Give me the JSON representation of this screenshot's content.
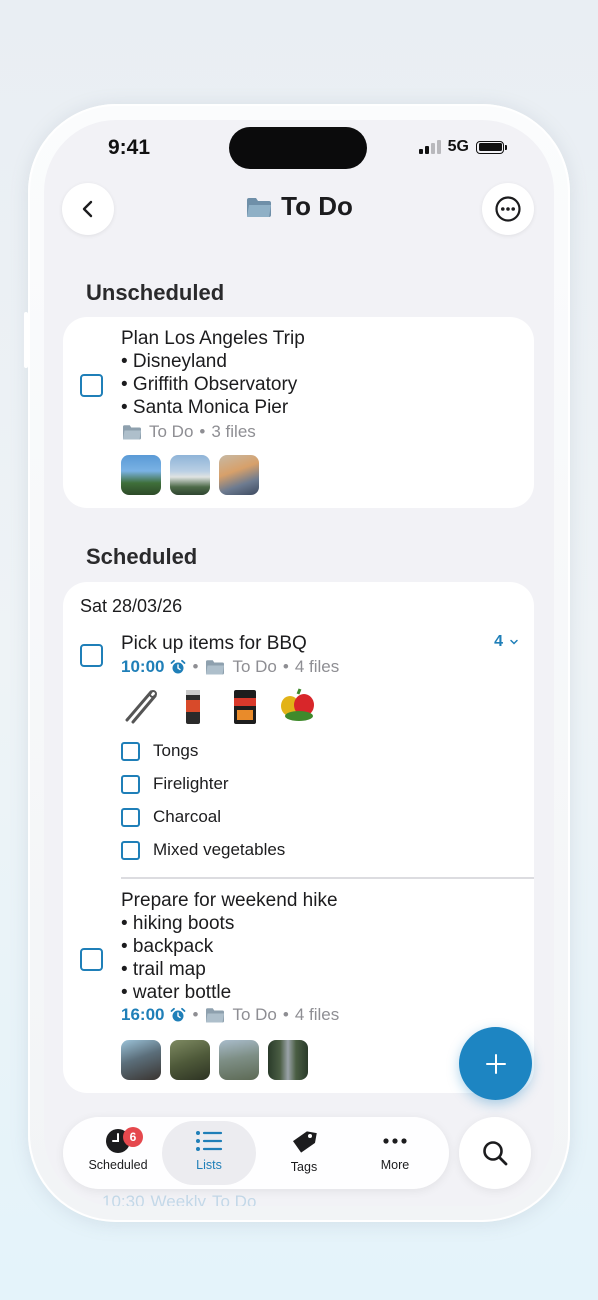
{
  "status": {
    "time": "9:41",
    "network": "5G"
  },
  "header": {
    "title": "To Do",
    "back_icon": "chevron-left-icon",
    "more_icon": "ellipsis-circle-icon",
    "folder_icon": "folder-icon"
  },
  "unscheduled": {
    "heading": "Unscheduled",
    "task": {
      "title": "Plan Los Angeles Trip",
      "bullets": [
        "• Disneyland",
        "• Griffith Observatory",
        "• Santa Monica Pier"
      ],
      "list": "To Do",
      "sep": "•",
      "files": "3 files",
      "thumbs": [
        "disneyland-photo",
        "griffith-observatory-photo",
        "santa-monica-photo"
      ]
    }
  },
  "scheduled": {
    "heading": "Scheduled",
    "date": "Sat 28/03/26",
    "task1": {
      "title": "Pick up items for BBQ",
      "count": "4",
      "time": "10:00",
      "list": "To Do",
      "sep": "•",
      "files": "4 files",
      "subtasks": [
        "Tongs",
        "Firelighter",
        "Charcoal",
        "Mixed vegetables"
      ]
    },
    "task2": {
      "title": "Prepare for weekend hike",
      "bullets": [
        "• hiking boots",
        "• backpack",
        "• trail map",
        "• water bottle"
      ],
      "time": "16:00",
      "list": "To Do",
      "sep": "•",
      "files": "4 files"
    },
    "ghost": {
      "time": "10:30",
      "repeat": "Weekly",
      "list": "To Do"
    }
  },
  "tabbar": {
    "scheduled": {
      "label": "Scheduled",
      "badge": "6"
    },
    "lists": {
      "label": "Lists"
    },
    "tags": {
      "label": "Tags"
    },
    "more": {
      "label": "More"
    }
  },
  "colors": {
    "accent": "#1f7fb8",
    "fab": "#1d85c2",
    "badge": "#e5484d",
    "screen_bg": "#f2f2f6"
  }
}
